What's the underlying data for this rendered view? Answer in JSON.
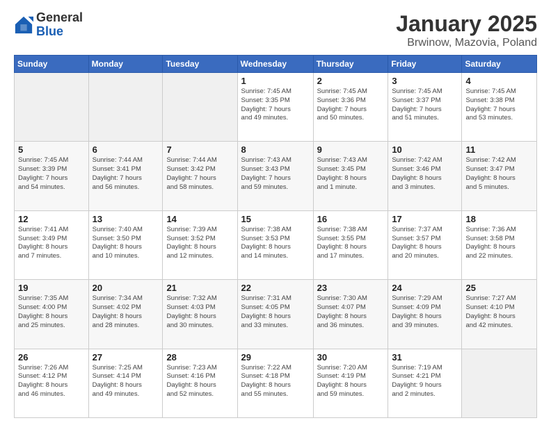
{
  "header": {
    "logo_general": "General",
    "logo_blue": "Blue",
    "title": "January 2025",
    "subtitle": "Brwinow, Mazovia, Poland"
  },
  "calendar": {
    "days_of_week": [
      "Sunday",
      "Monday",
      "Tuesday",
      "Wednesday",
      "Thursday",
      "Friday",
      "Saturday"
    ],
    "weeks": [
      [
        {
          "day": "",
          "info": ""
        },
        {
          "day": "",
          "info": ""
        },
        {
          "day": "",
          "info": ""
        },
        {
          "day": "1",
          "info": "Sunrise: 7:45 AM\nSunset: 3:35 PM\nDaylight: 7 hours\nand 49 minutes."
        },
        {
          "day": "2",
          "info": "Sunrise: 7:45 AM\nSunset: 3:36 PM\nDaylight: 7 hours\nand 50 minutes."
        },
        {
          "day": "3",
          "info": "Sunrise: 7:45 AM\nSunset: 3:37 PM\nDaylight: 7 hours\nand 51 minutes."
        },
        {
          "day": "4",
          "info": "Sunrise: 7:45 AM\nSunset: 3:38 PM\nDaylight: 7 hours\nand 53 minutes."
        }
      ],
      [
        {
          "day": "5",
          "info": "Sunrise: 7:45 AM\nSunset: 3:39 PM\nDaylight: 7 hours\nand 54 minutes."
        },
        {
          "day": "6",
          "info": "Sunrise: 7:44 AM\nSunset: 3:41 PM\nDaylight: 7 hours\nand 56 minutes."
        },
        {
          "day": "7",
          "info": "Sunrise: 7:44 AM\nSunset: 3:42 PM\nDaylight: 7 hours\nand 58 minutes."
        },
        {
          "day": "8",
          "info": "Sunrise: 7:43 AM\nSunset: 3:43 PM\nDaylight: 7 hours\nand 59 minutes."
        },
        {
          "day": "9",
          "info": "Sunrise: 7:43 AM\nSunset: 3:45 PM\nDaylight: 8 hours\nand 1 minute."
        },
        {
          "day": "10",
          "info": "Sunrise: 7:42 AM\nSunset: 3:46 PM\nDaylight: 8 hours\nand 3 minutes."
        },
        {
          "day": "11",
          "info": "Sunrise: 7:42 AM\nSunset: 3:47 PM\nDaylight: 8 hours\nand 5 minutes."
        }
      ],
      [
        {
          "day": "12",
          "info": "Sunrise: 7:41 AM\nSunset: 3:49 PM\nDaylight: 8 hours\nand 7 minutes."
        },
        {
          "day": "13",
          "info": "Sunrise: 7:40 AM\nSunset: 3:50 PM\nDaylight: 8 hours\nand 10 minutes."
        },
        {
          "day": "14",
          "info": "Sunrise: 7:39 AM\nSunset: 3:52 PM\nDaylight: 8 hours\nand 12 minutes."
        },
        {
          "day": "15",
          "info": "Sunrise: 7:38 AM\nSunset: 3:53 PM\nDaylight: 8 hours\nand 14 minutes."
        },
        {
          "day": "16",
          "info": "Sunrise: 7:38 AM\nSunset: 3:55 PM\nDaylight: 8 hours\nand 17 minutes."
        },
        {
          "day": "17",
          "info": "Sunrise: 7:37 AM\nSunset: 3:57 PM\nDaylight: 8 hours\nand 20 minutes."
        },
        {
          "day": "18",
          "info": "Sunrise: 7:36 AM\nSunset: 3:58 PM\nDaylight: 8 hours\nand 22 minutes."
        }
      ],
      [
        {
          "day": "19",
          "info": "Sunrise: 7:35 AM\nSunset: 4:00 PM\nDaylight: 8 hours\nand 25 minutes."
        },
        {
          "day": "20",
          "info": "Sunrise: 7:34 AM\nSunset: 4:02 PM\nDaylight: 8 hours\nand 28 minutes."
        },
        {
          "day": "21",
          "info": "Sunrise: 7:32 AM\nSunset: 4:03 PM\nDaylight: 8 hours\nand 30 minutes."
        },
        {
          "day": "22",
          "info": "Sunrise: 7:31 AM\nSunset: 4:05 PM\nDaylight: 8 hours\nand 33 minutes."
        },
        {
          "day": "23",
          "info": "Sunrise: 7:30 AM\nSunset: 4:07 PM\nDaylight: 8 hours\nand 36 minutes."
        },
        {
          "day": "24",
          "info": "Sunrise: 7:29 AM\nSunset: 4:09 PM\nDaylight: 8 hours\nand 39 minutes."
        },
        {
          "day": "25",
          "info": "Sunrise: 7:27 AM\nSunset: 4:10 PM\nDaylight: 8 hours\nand 42 minutes."
        }
      ],
      [
        {
          "day": "26",
          "info": "Sunrise: 7:26 AM\nSunset: 4:12 PM\nDaylight: 8 hours\nand 46 minutes."
        },
        {
          "day": "27",
          "info": "Sunrise: 7:25 AM\nSunset: 4:14 PM\nDaylight: 8 hours\nand 49 minutes."
        },
        {
          "day": "28",
          "info": "Sunrise: 7:23 AM\nSunset: 4:16 PM\nDaylight: 8 hours\nand 52 minutes."
        },
        {
          "day": "29",
          "info": "Sunrise: 7:22 AM\nSunset: 4:18 PM\nDaylight: 8 hours\nand 55 minutes."
        },
        {
          "day": "30",
          "info": "Sunrise: 7:20 AM\nSunset: 4:19 PM\nDaylight: 8 hours\nand 59 minutes."
        },
        {
          "day": "31",
          "info": "Sunrise: 7:19 AM\nSunset: 4:21 PM\nDaylight: 9 hours\nand 2 minutes."
        },
        {
          "day": "",
          "info": ""
        }
      ]
    ]
  }
}
